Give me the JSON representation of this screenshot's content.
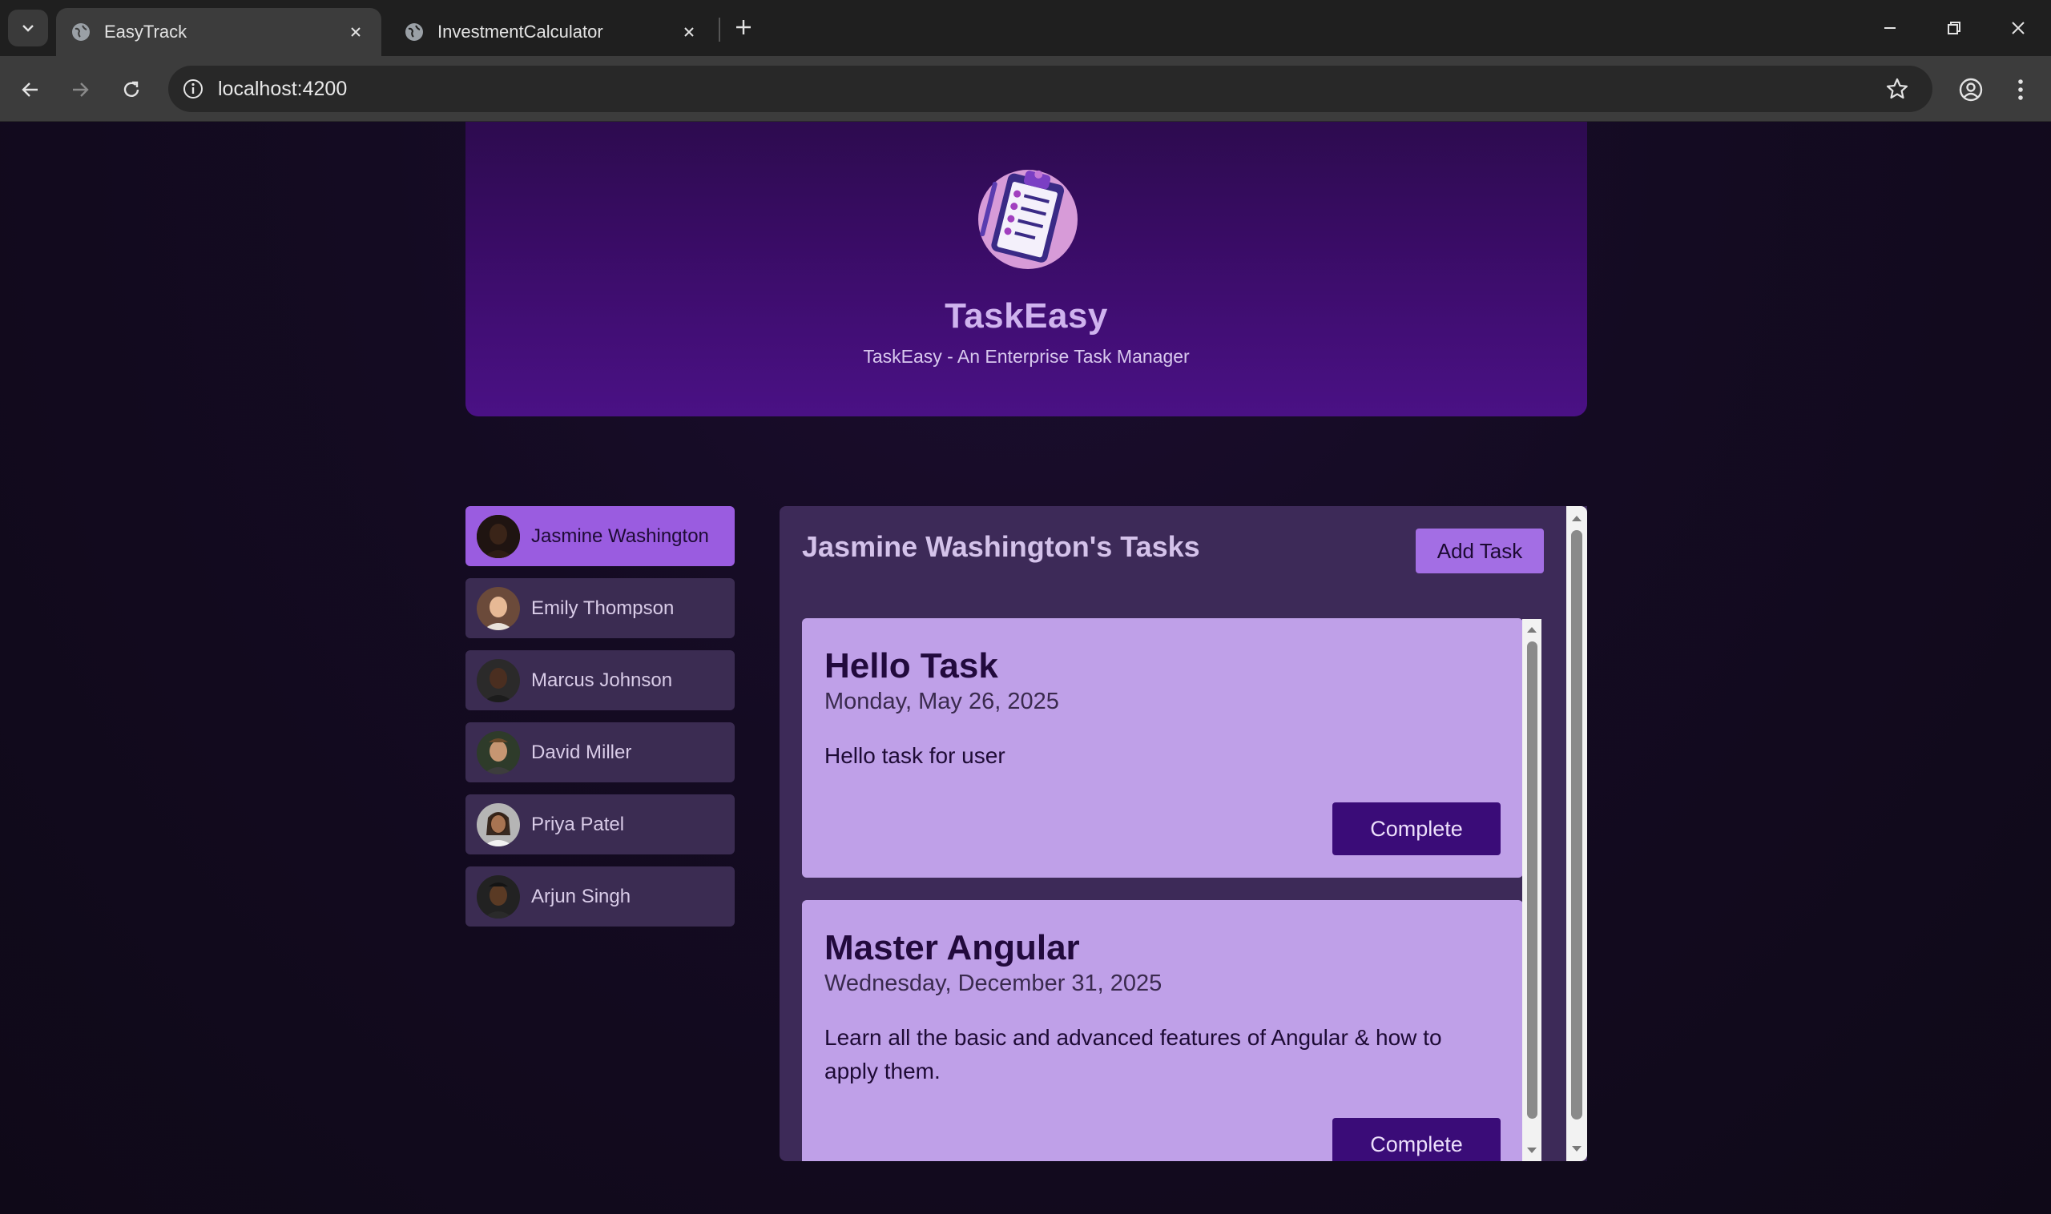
{
  "browser": {
    "tabs": [
      {
        "title": "EasyTrack",
        "active": true
      },
      {
        "title": "InvestmentCalculator",
        "active": false
      }
    ],
    "url": "localhost:4200"
  },
  "header": {
    "title": "TaskEasy",
    "subtitle": "TaskEasy - An Enterprise Task Manager"
  },
  "users": [
    {
      "name": "Jasmine Washington",
      "selected": true,
      "avatar_color": "#3a2418"
    },
    {
      "name": "Emily Thompson",
      "selected": false,
      "avatar_color": "#d9a27c"
    },
    {
      "name": "Marcus Johnson",
      "selected": false,
      "avatar_color": "#4a2e20"
    },
    {
      "name": "David Miller",
      "selected": false,
      "avatar_color": "#a77a55"
    },
    {
      "name": "Priya Patel",
      "selected": false,
      "avatar_color": "#8d6040"
    },
    {
      "name": "Arjun Singh",
      "selected": false,
      "avatar_color": "#3e2a1c"
    }
  ],
  "tasks_panel": {
    "title": "Jasmine Washington's Tasks",
    "add_button": "Add Task",
    "tasks": [
      {
        "title": "Hello Task",
        "date": "Monday, May 26, 2025",
        "summary": "Hello task for user",
        "button": "Complete"
      },
      {
        "title": "Master Angular",
        "date": "Wednesday, December 31, 2025",
        "summary": "Learn all the basic and advanced features of Angular & how to apply them.",
        "button": "Complete"
      }
    ]
  },
  "colors": {
    "header_bg": "#3f0d70",
    "selected_user": "#9a5ce0",
    "card_bg": "#bfa0e8",
    "complete_btn": "#3a0c78"
  }
}
